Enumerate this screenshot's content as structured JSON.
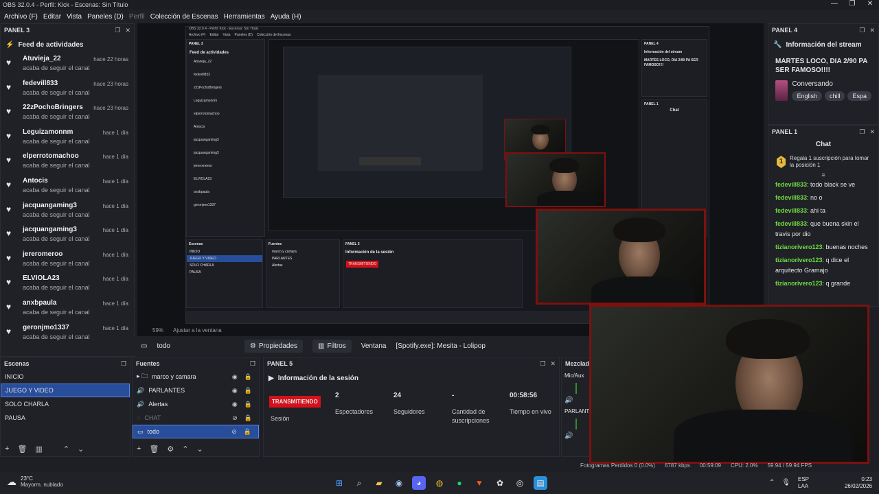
{
  "window": {
    "title": "OBS 32.0.4 - Perfil: Kick - Escenas: Sin Título",
    "controls": [
      "—",
      "❐",
      "✕"
    ]
  },
  "menu": [
    "Archivo (F)",
    "Editar",
    "Vista",
    "Paneles (D)",
    "Perfil",
    "Colección de Escenas",
    "Herramientas",
    "Ayuda (H)"
  ],
  "panel3": {
    "header": "PANEL 3",
    "title": "Feed de actividades",
    "items": [
      {
        "user": "Atuvieja_22",
        "action": "acaba de seguir el canal",
        "time": "hace 22 horas"
      },
      {
        "user": "fedevill833",
        "action": "acaba de seguir el canal",
        "time": "hace 23 horas"
      },
      {
        "user": "22zPochoBringers",
        "action": "acaba de seguir el canal",
        "time": "hace 23 horas"
      },
      {
        "user": "Leguizamonnm",
        "action": "acaba de seguir el canal",
        "time": "hace 1 día"
      },
      {
        "user": "elperrotomachoo",
        "action": "acaba de seguir el canal",
        "time": "hace 1 día"
      },
      {
        "user": "Antocis",
        "action": "acaba de seguir el canal",
        "time": "hace 1 día"
      },
      {
        "user": "jacquangaming3",
        "action": "acaba de seguir el canal",
        "time": "hace 1 día"
      },
      {
        "user": "jacquangaming3",
        "action": "acaba de seguir el canal",
        "time": "hace 1 día"
      },
      {
        "user": "jereromeroo",
        "action": "acaba de seguir el canal",
        "time": "hace 1 día"
      },
      {
        "user": "ELVIOLA23",
        "action": "acaba de seguir el canal",
        "time": "hace 1 día"
      },
      {
        "user": "anxbpaula",
        "action": "acaba de seguir el canal",
        "time": "hace 1 día"
      },
      {
        "user": "geronjmo1337",
        "action": "acaba de seguir el canal",
        "time": "hace 1 día"
      }
    ]
  },
  "panel4": {
    "header": "PANEL 4",
    "title": "Información del stream",
    "stream_title": "MARTES LOCO, DIA 2/90 PA SER FAMOSO!!!!",
    "category": "Conversando",
    "tags": [
      "English",
      "chill",
      "Espa"
    ]
  },
  "panel1": {
    "header": "PANEL 1",
    "title": "Chat",
    "gift": "Regala 1 suscripción para tomar la posición 1",
    "gift_count": "1",
    "messages": [
      {
        "user": "fedevill833",
        "text": "todo black se ve"
      },
      {
        "user": "fedevill833",
        "text": "no o"
      },
      {
        "user": "fedevill833",
        "text": "ahi ta"
      },
      {
        "user": "fedevill833",
        "text": "que buena skin el travis por dio"
      },
      {
        "user": "tizianorivero123",
        "text": "buenas noches"
      },
      {
        "user": "tizianorivero123",
        "text": "q dice el arquitecto Gramajo"
      },
      {
        "user": "tizianorivero123",
        "text": "q grande"
      }
    ]
  },
  "preview_bar": {
    "zoom": "59%",
    "fit": "Ajustar a la ventana",
    "source": "todo",
    "properties": "Propiedades",
    "filters": "Filtros",
    "window_label": "Ventana",
    "window_value": "[Spotify.exe]: Mesita - Lolipop"
  },
  "scenes": {
    "header": "Escenas",
    "items": [
      "INICIO",
      "JUEGO Y VIDEO",
      "SOLO CHARLA",
      "PAUSA"
    ],
    "selected": "JUEGO Y VIDEO"
  },
  "sources": {
    "header": "Fuentes",
    "items": [
      {
        "name": "marco y camara",
        "type": "folder"
      },
      {
        "name": "PARLANTES",
        "type": "audio"
      },
      {
        "name": "Alertas",
        "type": "audio"
      },
      {
        "name": "CHAT",
        "type": "browser"
      },
      {
        "name": "todo",
        "type": "window"
      }
    ]
  },
  "panel5": {
    "header": "PANEL 5",
    "title": "Información de la sesión",
    "live_badge": "TRANSMITIENDO",
    "session_label": "Sesión",
    "stats": [
      {
        "value": "2",
        "label": "Espectadores"
      },
      {
        "value": "24",
        "label": "Seguidores"
      },
      {
        "value": "-",
        "label": "Cantidad de suscripciones"
      },
      {
        "value": "00:58:56",
        "label": "Tiempo en vivo"
      }
    ]
  },
  "mixer": {
    "header": "Mezclad",
    "channels": [
      "Mic/Aux",
      "PARLANTI"
    ]
  },
  "statusbar": {
    "frames": "Fotogramas Perdidos 0 (0.0%)",
    "kbps": "6787 kbps",
    "time": "00:59:09",
    "cpu": "CPU: 2.0%",
    "fps": "59.94 / 59.94 FPS"
  },
  "taskbar": {
    "weather_temp": "23°C",
    "weather_desc": "Mayorm. nublado",
    "lang": "ESP",
    "lang2": "LAA",
    "clock_time": "0:23",
    "clock_date": "26/02/2026"
  },
  "colors": {
    "accent": "#284e9b",
    "live": "#d4111a",
    "chat_user": "#6fda3f",
    "cam_border": "#7e1010"
  }
}
